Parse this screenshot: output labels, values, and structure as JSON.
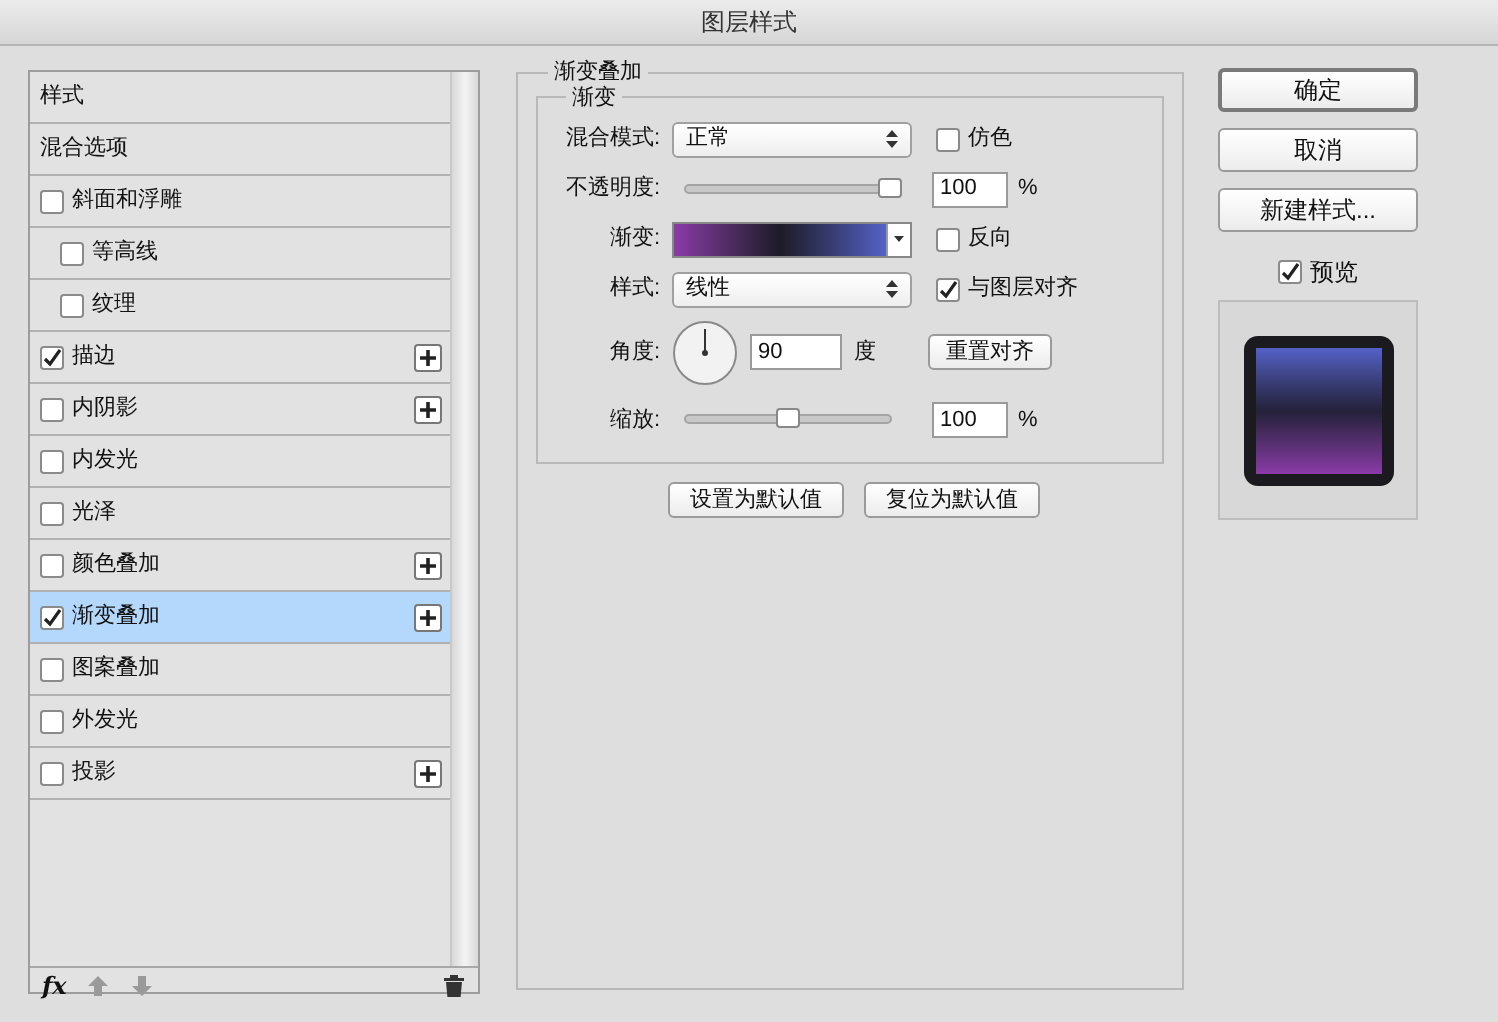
{
  "window": {
    "title": "图层样式"
  },
  "styles_list": {
    "items": [
      {
        "label": "样式",
        "kind": "header",
        "selected": false
      },
      {
        "label": "混合选项",
        "kind": "header",
        "selected": false
      },
      {
        "label": "斜面和浮雕",
        "kind": "effect",
        "checked": false,
        "addable": false,
        "selected": false,
        "children": [
          {
            "label": "等高线",
            "kind": "effect",
            "checked": false,
            "addable": false,
            "selected": false
          },
          {
            "label": "纹理",
            "kind": "effect",
            "checked": false,
            "addable": false,
            "selected": false
          }
        ]
      },
      {
        "label": "描边",
        "kind": "effect",
        "checked": true,
        "addable": true,
        "selected": false
      },
      {
        "label": "内阴影",
        "kind": "effect",
        "checked": false,
        "addable": true,
        "selected": false
      },
      {
        "label": "内发光",
        "kind": "effect",
        "checked": false,
        "addable": false,
        "selected": false
      },
      {
        "label": "光泽",
        "kind": "effect",
        "checked": false,
        "addable": false,
        "selected": false
      },
      {
        "label": "颜色叠加",
        "kind": "effect",
        "checked": false,
        "addable": true,
        "selected": false
      },
      {
        "label": "渐变叠加",
        "kind": "effect",
        "checked": true,
        "addable": true,
        "selected": true
      },
      {
        "label": "图案叠加",
        "kind": "effect",
        "checked": false,
        "addable": false,
        "selected": false
      },
      {
        "label": "外发光",
        "kind": "effect",
        "checked": false,
        "addable": false,
        "selected": false
      },
      {
        "label": "投影",
        "kind": "effect",
        "checked": false,
        "addable": true,
        "selected": false
      }
    ],
    "toolbar": {
      "fx_label": "fx"
    }
  },
  "panel": {
    "title": "渐变叠加",
    "group": "渐变",
    "blend_mode": {
      "label": "混合模式:",
      "value": "正常"
    },
    "dither": {
      "label": "仿色",
      "checked": false
    },
    "opacity": {
      "label": "不透明度:",
      "level": 1,
      "value": "100",
      "unit": "%"
    },
    "gradient": {
      "label": "渐变:"
    },
    "reverse": {
      "label": "反向",
      "checked": false
    },
    "style": {
      "label": "样式:",
      "value": "线性"
    },
    "align": {
      "label": "与图层对齐",
      "checked": true
    },
    "angle": {
      "label": "角度:",
      "value": "90",
      "unit": "度"
    },
    "reset_button": "重置对齐",
    "scale": {
      "label": "缩放:",
      "level": 0.5,
      "value": "100",
      "unit": "%"
    },
    "buttons": [
      "设置为默认值",
      "复位为默认值"
    ]
  },
  "actions": [
    {
      "label": "确定",
      "default": true
    },
    {
      "label": "取消",
      "default": false
    },
    {
      "label": "新建样式...",
      "default": false
    }
  ],
  "preview": {
    "label": "预览",
    "checked": true
  }
}
